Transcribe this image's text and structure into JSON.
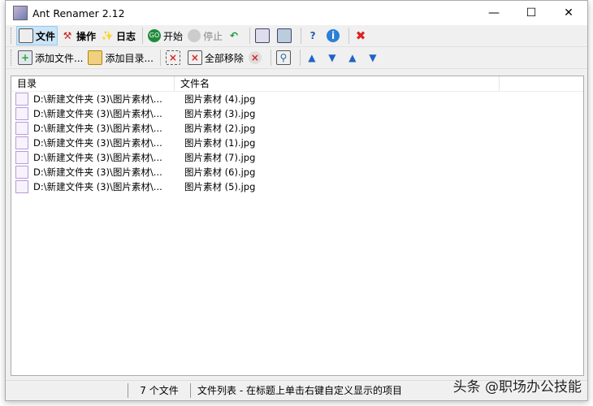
{
  "window": {
    "title": "Ant Renamer 2.12"
  },
  "toolbar1": {
    "file": "文件",
    "actions": "操作",
    "log": "日志",
    "start": "开始",
    "stop": "停止"
  },
  "toolbar2": {
    "add_files": "添加文件...",
    "add_folder": "添加目录...",
    "remove_all": "全部移除"
  },
  "list": {
    "columns": [
      "目录",
      "文件名"
    ],
    "rows": [
      {
        "dir": "D:\\新建文件夹 (3)\\图片素材\\...",
        "name": "图片素材 (4).jpg"
      },
      {
        "dir": "D:\\新建文件夹 (3)\\图片素材\\...",
        "name": "图片素材 (3).jpg"
      },
      {
        "dir": "D:\\新建文件夹 (3)\\图片素材\\...",
        "name": "图片素材 (2).jpg"
      },
      {
        "dir": "D:\\新建文件夹 (3)\\图片素材\\...",
        "name": "图片素材 (1).jpg"
      },
      {
        "dir": "D:\\新建文件夹 (3)\\图片素材\\...",
        "name": "图片素材 (7).jpg"
      },
      {
        "dir": "D:\\新建文件夹 (3)\\图片素材\\...",
        "name": "图片素材 (6).jpg"
      },
      {
        "dir": "D:\\新建文件夹 (3)\\图片素材\\...",
        "name": "图片素材 (5).jpg"
      }
    ]
  },
  "status": {
    "count": "7 个文件",
    "hint": "文件列表 - 在标题上单击右键自定义显示的项目"
  },
  "watermark": "头条 @职场办公技能"
}
